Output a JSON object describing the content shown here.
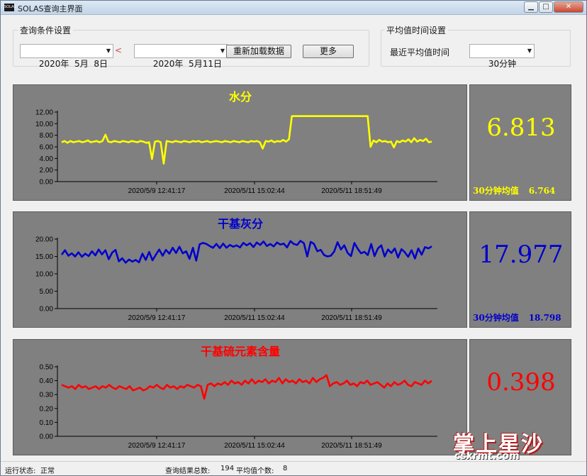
{
  "window": {
    "icon_text": "SOLAS",
    "title": "SOLAS查询主界面",
    "min_glyph": "▁",
    "max_glyph": "□",
    "close_glyph": "✕"
  },
  "query": {
    "group_title": "查询条件设置",
    "start_date": "2020年  5月  8日",
    "range_sep": "<",
    "end_date": "2020年  5月11日",
    "reload_label": "重新加载数据",
    "more_label": "更多"
  },
  "avg_setting": {
    "group_title": "平均值时间设置",
    "label": "最近平均值时间",
    "value": "30分钟"
  },
  "x_ticks": [
    "2020/5/9 12:41:17",
    "2020/5/11 15:02:44",
    "2020/5/11 18:51:49"
  ],
  "panels": [
    {
      "title": "水分",
      "color": "#ffff00",
      "current": "6.813",
      "avg_label": "30分钟均值",
      "avg_value": "6.764",
      "yticks": [
        "12.00",
        "10.00",
        "8.00",
        "6.00",
        "4.00",
        "2.00",
        "0.00"
      ]
    },
    {
      "title": "干基灰分",
      "color": "#0000cc",
      "current": "17.977",
      "avg_label": "30分钟均值",
      "avg_value": "18.798",
      "yticks": [
        "20.00",
        "15.00",
        "10.00",
        "5.00",
        "0.00"
      ]
    },
    {
      "title": "干基硫元素含量",
      "color": "#ff0000",
      "current": "0.398",
      "avg_label": "",
      "avg_value": "",
      "yticks": [
        "0.50",
        "0.40",
        "0.30",
        "0.20",
        "0.10",
        "0.00"
      ]
    }
  ],
  "chart_data": [
    {
      "type": "line",
      "title": "水分",
      "ylim": [
        0,
        12
      ],
      "x_tick_labels": [
        "2020/5/9 12:41:17",
        "2020/5/11 15:02:44",
        "2020/5/11 18:51:49"
      ],
      "series": [
        {
          "values": [
            6.8,
            7.0,
            6.7,
            7.0,
            6.8,
            6.9,
            7.0,
            6.8,
            6.9,
            7.1,
            6.8,
            6.9,
            7.0,
            6.8,
            7.0,
            8.1,
            6.9,
            6.8,
            7.0,
            6.9,
            6.8,
            7.0,
            6.9,
            6.8,
            7.0,
            6.9,
            6.8,
            7.0,
            6.9,
            6.7,
            6.8,
            3.9,
            6.9,
            7.0,
            6.8,
            3.1,
            7.0,
            6.9,
            6.8,
            7.0,
            6.9,
            6.8,
            7.0,
            6.9,
            6.8,
            7.0,
            6.9,
            7.0,
            6.8,
            6.9,
            7.0,
            6.8,
            6.9,
            7.0,
            6.9,
            6.8,
            7.0,
            6.9,
            6.8,
            7.0,
            6.9,
            6.8,
            7.0,
            6.9,
            6.8,
            7.0,
            6.9,
            7.0,
            6.8,
            5.7,
            7.0,
            6.9,
            7.1,
            6.8,
            7.0,
            6.9,
            7.2,
            6.9,
            7.3,
            11.3,
            11.3,
            11.3,
            11.3,
            11.3,
            11.3,
            11.3,
            11.3,
            11.3,
            11.3,
            11.3,
            11.3,
            11.3,
            11.3,
            11.3,
            11.3,
            11.3,
            11.3,
            11.3,
            11.3,
            11.3,
            11.3,
            11.3,
            11.3,
            11.3,
            11.3,
            11.3,
            6.0,
            7.1,
            6.8,
            7.2,
            6.9,
            7.0,
            6.8,
            6.9,
            5.9,
            7.0,
            6.8,
            7.1,
            6.9,
            7.3,
            6.8,
            7.5,
            6.9,
            7.2,
            7.0,
            7.4,
            6.8,
            6.9
          ]
        }
      ]
    },
    {
      "type": "line",
      "title": "干基灰分",
      "ylim": [
        0,
        20
      ],
      "x_tick_labels": [
        "2020/5/9 12:41:17",
        "2020/5/11 15:02:44",
        "2020/5/11 18:51:49"
      ],
      "series": [
        {
          "values": [
            15.5,
            16.8,
            15.2,
            15.9,
            15.0,
            16.2,
            14.9,
            15.8,
            15.1,
            16.5,
            15.3,
            17.0,
            15.6,
            16.8,
            14.2,
            16.1,
            16.9,
            13.6,
            14.5,
            13.2,
            14.1,
            13.5,
            14.0,
            13.3,
            15.8,
            14.0,
            16.3,
            13.9,
            15.5,
            17.0,
            15.2,
            16.9,
            15.8,
            17.5,
            16.0,
            17.8,
            15.9,
            16.5,
            14.3,
            17.5,
            13.8,
            18.5,
            18.9,
            18.6,
            18.0,
            17.5,
            18.6,
            17.4,
            18.7,
            17.5,
            18.3,
            17.8,
            18.2,
            17.6,
            18.9,
            18.2,
            18.8,
            17.7,
            19.0,
            18.3,
            19.3,
            18.0,
            18.6,
            17.9,
            19.0,
            18.4,
            18.7,
            17.6,
            19.4,
            18.6,
            18.3,
            19.5,
            18.8,
            15.0,
            19.2,
            18.6,
            16.5,
            16.9,
            15.4,
            15.0,
            15.2,
            16.4,
            19.1,
            17.0,
            18.2,
            16.0,
            15.1,
            18.9,
            17.2,
            15.9,
            16.3,
            15.4,
            18.6,
            15.1,
            17.3,
            18.2,
            15.0,
            17.0,
            16.0,
            17.3,
            14.7,
            17.1,
            16.2,
            14.9,
            16.8,
            14.4,
            17.3,
            15.5,
            17.7,
            17.3,
            17.9
          ]
        }
      ]
    },
    {
      "type": "line",
      "title": "干基硫元素含量",
      "ylim": [
        0,
        0.5
      ],
      "x_tick_labels": [
        "2020/5/9 12:41:17",
        "2020/5/11 15:02:44",
        "2020/5/11 18:51:49"
      ],
      "series": [
        {
          "values": [
            0.37,
            0.36,
            0.35,
            0.36,
            0.34,
            0.37,
            0.35,
            0.36,
            0.34,
            0.35,
            0.36,
            0.34,
            0.36,
            0.35,
            0.37,
            0.35,
            0.34,
            0.36,
            0.35,
            0.34,
            0.36,
            0.33,
            0.34,
            0.35,
            0.33,
            0.34,
            0.36,
            0.35,
            0.37,
            0.35,
            0.34,
            0.37,
            0.35,
            0.36,
            0.34,
            0.36,
            0.35,
            0.37,
            0.36,
            0.35,
            0.37,
            0.36,
            0.27,
            0.37,
            0.38,
            0.36,
            0.38,
            0.37,
            0.39,
            0.37,
            0.4,
            0.38,
            0.39,
            0.37,
            0.4,
            0.38,
            0.41,
            0.38,
            0.4,
            0.39,
            0.41,
            0.38,
            0.4,
            0.39,
            0.42,
            0.38,
            0.41,
            0.39,
            0.4,
            0.38,
            0.41,
            0.39,
            0.4,
            0.38,
            0.42,
            0.39,
            0.41,
            0.42,
            0.44,
            0.36,
            0.38,
            0.39,
            0.37,
            0.38,
            0.4,
            0.37,
            0.38,
            0.36,
            0.39,
            0.38,
            0.4,
            0.37,
            0.38,
            0.39,
            0.37,
            0.35,
            0.38,
            0.36,
            0.39,
            0.37,
            0.38,
            0.4,
            0.37,
            0.36,
            0.39,
            0.38,
            0.37,
            0.4,
            0.38,
            0.4
          ]
        }
      ]
    }
  ],
  "status": {
    "label": "运行状态:",
    "value": "正常",
    "total_label": "查询结果总数:",
    "total_value": "194",
    "avg_count_label": "平均值个数:",
    "avg_count_value": "8"
  },
  "watermark": {
    "text": "掌上星沙",
    "sub": "csxrmt.com"
  }
}
